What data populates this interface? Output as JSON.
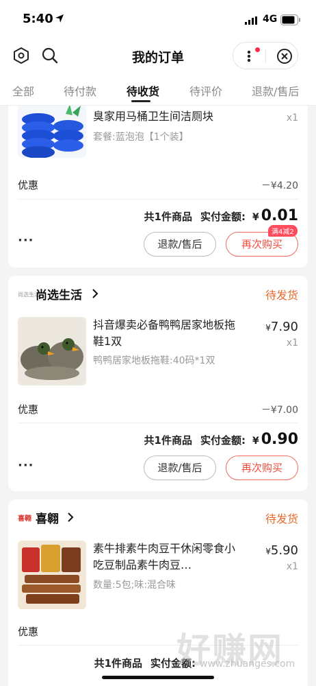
{
  "status_bar": {
    "time": "5:40",
    "network": "4G"
  },
  "header": {
    "title": "我的订单"
  },
  "tabs": [
    {
      "label": "全部"
    },
    {
      "label": "待付款"
    },
    {
      "label": "待收货"
    },
    {
      "label": "待评价"
    },
    {
      "label": "退款/售后"
    }
  ],
  "orders": [
    {
      "product": {
        "title": "臭家用马桶卫生间洁厕块",
        "spec": "套餐:蓝泡泡【1个装】",
        "qty": "x1"
      },
      "discount_label": "优惠",
      "discount_value": "－¥4.20",
      "total_text": "共1件商品",
      "paid_label": "实付金额:",
      "currency": "¥",
      "paid_amount": "0.01",
      "promo_tag": "满4减2",
      "more": "···",
      "refund_button": "退款/售后",
      "rebuy_button": "再次购买"
    },
    {
      "shop_name": "尚选生活",
      "shop_logo_text": "尚选生活",
      "status": "待发货",
      "product": {
        "title": "抖音爆卖必备鸭鸭居家地板拖鞋1双",
        "spec": "鸭鸭居家地板拖鞋:40码*1双",
        "price": "7.90",
        "qty": "x1"
      },
      "discount_label": "优惠",
      "discount_value": "－¥7.00",
      "total_text": "共1件商品",
      "paid_label": "实付金额:",
      "currency": "¥",
      "paid_amount": "0.90",
      "more": "···",
      "refund_button": "退款/售后",
      "rebuy_button": "再次购买"
    },
    {
      "shop_name": "喜翱",
      "shop_logo_text": "喜翱",
      "status": "待发货",
      "product": {
        "title": "素牛排素牛肉豆干休闲零食小吃豆制品素牛肉豆…",
        "spec": "数量:5包;味:混合味",
        "price": "5.90",
        "qty": "x1"
      },
      "discount_label": "优惠",
      "total_text": "共1件商品",
      "paid_label": "实付金额:"
    }
  ],
  "price_currency": "¥",
  "watermark": {
    "text": "好赚网",
    "sub": "www.zhuanges.com"
  },
  "colors": {
    "accent": "#f04a3a",
    "status": "#e66a2c",
    "promo": "#ff4d5e"
  }
}
